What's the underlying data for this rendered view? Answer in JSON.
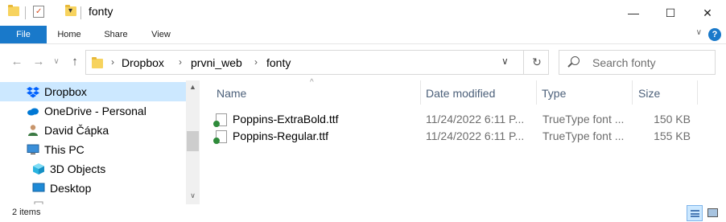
{
  "window": {
    "title": "fonty",
    "minimize_glyph": "—",
    "maximize_glyph": "☐",
    "close_glyph": "✕"
  },
  "quick_access": {
    "qa_dropdown_glyph": "▾"
  },
  "ribbon": {
    "tabs": [
      {
        "label": "File"
      },
      {
        "label": "Home"
      },
      {
        "label": "Share"
      },
      {
        "label": "View"
      }
    ],
    "collapse_glyph": "∨",
    "help_glyph": "?"
  },
  "navigation": {
    "back_glyph": "←",
    "forward_glyph": "→",
    "recent_glyph": "∨",
    "up_glyph": "↑",
    "address": {
      "breadcrumbs": [
        "Dropbox",
        "prvni_web",
        "fonty"
      ],
      "separator": "›",
      "dropdown_glyph": "∨",
      "refresh_glyph": "↻"
    },
    "search": {
      "placeholder": "Search fonty"
    }
  },
  "nav_pane": {
    "items": [
      {
        "label": "Dropbox",
        "icon": "dropbox-icon",
        "selected": true
      },
      {
        "label": "OneDrive - Personal",
        "icon": "onedrive-icon"
      },
      {
        "label": "David Čápka",
        "icon": "user-icon"
      },
      {
        "label": "This PC",
        "icon": "computer-icon"
      },
      {
        "label": "3D Objects",
        "icon": "cube-icon"
      },
      {
        "label": "Desktop",
        "icon": "desktop-icon"
      }
    ],
    "scroll_up_glyph": "▲",
    "scroll_down_glyph": "∨"
  },
  "file_list": {
    "sort_glyph": "^",
    "columns": [
      {
        "label": "Name"
      },
      {
        "label": "Date modified"
      },
      {
        "label": "Type"
      },
      {
        "label": "Size"
      }
    ],
    "rows": [
      {
        "name": "Poppins-ExtraBold.ttf",
        "date": "11/24/2022 6:11 P...",
        "type": "TrueType font ...",
        "size": "150 KB"
      },
      {
        "name": "Poppins-Regular.ttf",
        "date": "11/24/2022 6:11 P...",
        "type": "TrueType font ...",
        "size": "155 KB"
      }
    ]
  },
  "status": {
    "item_count": "2 items"
  },
  "colors": {
    "accent": "#1979ca",
    "selection": "#cce8ff",
    "header_text": "#4c607a"
  }
}
